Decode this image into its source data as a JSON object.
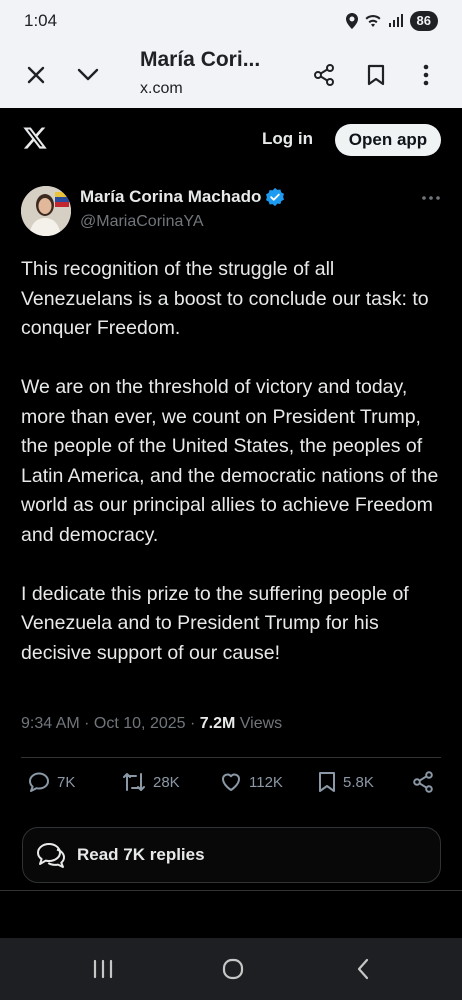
{
  "status_bar": {
    "time": "1:04",
    "battery": "86"
  },
  "browser": {
    "page_title": "María Cori...",
    "url": "x.com"
  },
  "x_header": {
    "login_label": "Log in",
    "open_app_label": "Open app"
  },
  "tweet": {
    "author_name": "María Corina Machado",
    "author_handle": "@MariaCorinaYA",
    "paragraphs": [
      "This recognition of the struggle of all Venezuelans is a boost to conclude our task: to conquer Freedom.",
      "We are on the threshold of victory and today, more than ever, we count on President Trump, the people of the United States, the peoples of Latin America, and the democratic nations of the world as our principal allies to achieve Freedom and democracy.",
      "I dedicate this prize to the suffering people of Venezuela and to President Trump for his decisive support of our cause!"
    ],
    "timestamp": "9:34 AM · Oct 10, 2025 · ",
    "views_count": "7.2M",
    "views_label": " Views",
    "stats": {
      "replies": "7K",
      "reposts": "28K",
      "likes": "112K",
      "bookmarks": "5.8K"
    },
    "read_replies_label": "Read 7K replies"
  },
  "colors": {
    "background": "#000000",
    "text_primary": "#e7e9ea",
    "text_secondary": "#71767b",
    "verified_badge": "#1d9bf0",
    "browser_bar": "#f1f3f6"
  }
}
